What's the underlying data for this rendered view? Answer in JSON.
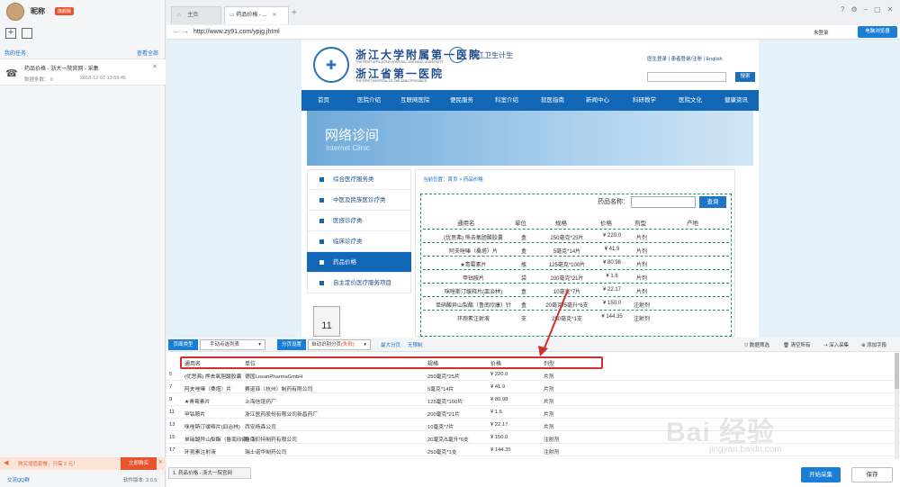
{
  "app": {
    "nickname": "昵称",
    "vip_badge": "旗舰版",
    "my_tasks": "我的任务",
    "view_all": "查看全部",
    "task": {
      "title": "药品价格 - 浙大一院官网 - 采集",
      "data_count": "数据条数： 0",
      "time": "2018-12-07 13:59:45"
    },
    "promo_text": "购买增值套餐，只需 2 元！",
    "buy_now": "立即购买",
    "qq_link": "交流QQ群",
    "version": "软件版本: 3.0.5"
  },
  "browser": {
    "tabs": [
      {
        "label": "主页"
      },
      {
        "label": "药品价格 - ..."
      }
    ],
    "new_tab": "+",
    "url": "http://www.zy91.com/ypjg.jhtml",
    "login_link": "未登录",
    "browse_mode": "电脑浏览器"
  },
  "site": {
    "name1": "浙江大学附属第一医院",
    "name1_en": "THE FIRST AFFILIATED HOSPITAL, ZHEJIANG UNIVERSITY",
    "name2": "浙江省第一医院",
    "name2_en": "THE FIRST HOSPITAL OF ZHEJIANG PROVINCE",
    "health_logo": "浙江卫生计生",
    "top_links": "医生登录  |  患者登录/注册  |  English",
    "search_btn": "搜索",
    "nav": [
      "首页",
      "医院介绍",
      "互联网医院",
      "便民服务",
      "科室介绍",
      "就医指南",
      "新闻中心",
      "科研教学",
      "医院文化",
      "健康资讯"
    ],
    "banner_cn": "网络诊间",
    "banner_en": "Internet  Clinic",
    "side_menu": [
      "综合医疗服务类",
      "中医及民族医诊疗类",
      "医技诊疗类",
      "临床诊疗类",
      "药品价格",
      "自主定价医疗服务项目"
    ],
    "calendar_day": "11",
    "breadcrumb": "当前位置：首页 > 药品价格",
    "drug_label": "药品名称：",
    "query_btn": "查询",
    "table_headers": [
      "通用名",
      "单位",
      "规格",
      "价格",
      "剂型",
      "产地"
    ],
    "rows": [
      [
        "(优思弗) 熊去氧胆酸胶囊",
        "盒",
        "250毫克*25片",
        "¥ 220.0",
        "片剂",
        ""
      ],
      [
        "阿夫唑嗪（桑塔）片",
        "盒",
        "5毫克*14片",
        "¥ 41.9",
        "片剂",
        ""
      ],
      [
        "★青霉素片",
        "瓶",
        "125毫克*100片",
        "¥ 80.98",
        "片剂",
        ""
      ],
      [
        "甲钴胺片",
        "袋",
        "200毫克*21片",
        "¥ 1.6",
        "片剂",
        ""
      ],
      [
        "咪唑斯汀缓释片(皿治林)",
        "盒",
        "10毫克*7片",
        "¥ 22.17",
        "片剂",
        ""
      ],
      [
        "单硝酸异山梨酯（鲁南欣康）针",
        "盒",
        "20毫克/5毫升*6支",
        "¥ 150.0",
        "注射剂",
        ""
      ],
      [
        "环孢素注射液",
        "支",
        "250毫克*1支",
        "¥ 144.35",
        "注射剂",
        ""
      ]
    ]
  },
  "tool": {
    "page_type_label": "页面类型",
    "page_type_value": "手动点选列表",
    "pagination_label": "分页设置",
    "pagination_value": "自动识别分页",
    "pagination_value_flag": "(失败)",
    "max_pages": "最大分页",
    "no_pagination": "无限制",
    "right_tools": [
      "数据筛选",
      "清空所有",
      "深入采集",
      "添加字段"
    ],
    "columns": [
      "通用名",
      "单位",
      "规格",
      "价格",
      "剂型"
    ],
    "rows": [
      {
        "n": "5",
        "name": "(优思弗) 熊去氧胆酸胶囊",
        "unit": "德国LosanPharmaGmbH",
        "spec": "250毫克*25片",
        "price": "¥ 220.0",
        "form": "片剂"
      },
      {
        "n": "7",
        "name": "阿夫唑嗪（桑塔）片",
        "unit": "赛诺菲（杭州）制药有限公司",
        "spec": "5毫克*14片",
        "price": "¥ 41.9",
        "form": "片剂"
      },
      {
        "n": "9",
        "name": "★青霉素片",
        "unit": "上海信谊药厂",
        "spec": "125毫克*100片",
        "price": "¥ 80.98",
        "form": "片剂"
      },
      {
        "n": "11",
        "name": "甲钴胺片",
        "unit": "浙江医药股份有限公司新昌药厂",
        "spec": "200毫克*21片",
        "price": "¥ 1.6",
        "form": "片剂"
      },
      {
        "n": "13",
        "name": "咪唑斯汀缓释片(皿治林)",
        "unit": "西安杨森公司",
        "spec": "10毫克*7片",
        "price": "¥ 22.17",
        "form": "片剂"
      },
      {
        "n": "15",
        "name": "单硝酸异山梨酯（鲁南欣康）针",
        "unit": "鲁南贝特制药有限公司",
        "spec": "20毫克/5毫升*6支",
        "price": "¥ 150.0",
        "form": "注射剂"
      },
      {
        "n": "17",
        "name": "环孢素注射液",
        "unit": "瑞士诺华制药公司",
        "spec": "250毫克*1支",
        "price": "¥ 144.35",
        "form": "注射剂"
      }
    ],
    "task_tab": "1. 药品价格 - 浙大一院官网",
    "start_btn": "开始采集",
    "save_btn": "保存"
  },
  "watermark": "Bai 经验",
  "watermark_url": "jingyan.baidu.com",
  "colors": {
    "accent": "#1a7ed4",
    "site_blue": "#1268b7",
    "highlight": "#d32f2f",
    "frame_green": "#1c9660"
  }
}
